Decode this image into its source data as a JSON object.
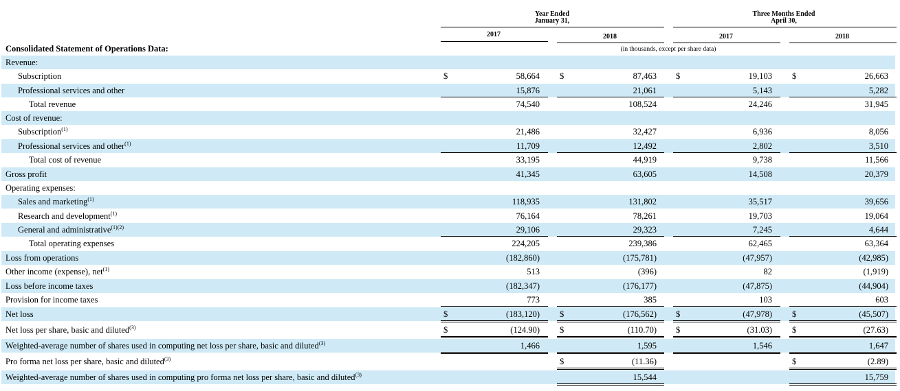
{
  "headers": {
    "year_ended": "Year Ended",
    "year_ended_date": "January 31,",
    "three_months": "Three Months Ended",
    "three_months_date": "April 30,",
    "columns": [
      "2017",
      "2018",
      "2017",
      "2018"
    ],
    "units": "(in thousands, except per share data)"
  },
  "section_title": "Consolidated Statement of Operations Data:",
  "rows": [
    {
      "label": "Revenue:",
      "indent": 0,
      "shade": true,
      "values": []
    },
    {
      "label": "Subscription",
      "indent": 1,
      "shade": false,
      "dollars": true,
      "values": [
        "58,664",
        "87,463",
        "19,103",
        "26,663"
      ]
    },
    {
      "label": "Professional services and other",
      "indent": 1,
      "shade": true,
      "values": [
        "15,876",
        "21,061",
        "5,143",
        "5,282"
      ]
    },
    {
      "label": "Total revenue",
      "indent": 2,
      "shade": false,
      "values": [
        "74,540",
        "108,524",
        "24,246",
        "31,945"
      ]
    },
    {
      "label": "Cost of revenue:",
      "indent": 0,
      "shade": true,
      "values": []
    },
    {
      "label": "Subscription",
      "sup": "(1)",
      "indent": 1,
      "shade": false,
      "values": [
        "21,486",
        "32,427",
        "6,936",
        "8,056"
      ]
    },
    {
      "label": "Professional services and other",
      "sup": "(1)",
      "indent": 1,
      "shade": true,
      "values": [
        "11,709",
        "12,492",
        "2,802",
        "3,510"
      ]
    },
    {
      "label": "Total cost of revenue",
      "indent": 2,
      "shade": false,
      "values": [
        "33,195",
        "44,919",
        "9,738",
        "11,566"
      ]
    },
    {
      "label": "Gross profit",
      "indent": 0,
      "shade": true,
      "values": [
        "41,345",
        "63,605",
        "14,508",
        "20,379"
      ]
    },
    {
      "label": "Operating expenses:",
      "indent": 0,
      "shade": false,
      "values": []
    },
    {
      "label": "Sales and marketing",
      "sup": "(1)",
      "indent": 1,
      "shade": true,
      "values": [
        "118,935",
        "131,802",
        "35,517",
        "39,656"
      ]
    },
    {
      "label": "Research and development",
      "sup": "(1)",
      "indent": 1,
      "shade": false,
      "values": [
        "76,164",
        "78,261",
        "19,703",
        "19,064"
      ]
    },
    {
      "label": "General and administrative",
      "sup": "(1)(2)",
      "indent": 1,
      "shade": true,
      "values": [
        "29,106",
        "29,323",
        "7,245",
        "4,644"
      ]
    },
    {
      "label": "Total operating expenses",
      "indent": 2,
      "shade": false,
      "values": [
        "224,205",
        "239,386",
        "62,465",
        "63,364"
      ]
    },
    {
      "label": "Loss from operations",
      "indent": 0,
      "shade": true,
      "values": [
        "(182,860)",
        "(175,781)",
        "(47,957)",
        "(42,985)"
      ]
    },
    {
      "label": "Other income (expense), net",
      "sup": "(1)",
      "indent": 0,
      "shade": false,
      "values": [
        "513",
        "(396)",
        "82",
        "(1,919)"
      ]
    },
    {
      "label": "Loss before income taxes",
      "indent": 0,
      "shade": true,
      "values": [
        "(182,347)",
        "(176,177)",
        "(47,875)",
        "(44,904)"
      ]
    },
    {
      "label": "Provision for income taxes",
      "indent": 0,
      "shade": false,
      "values": [
        "773",
        "385",
        "103",
        "603"
      ]
    },
    {
      "label": "Net loss",
      "indent": 0,
      "shade": true,
      "dollars": true,
      "values": [
        "(183,120)",
        "(176,562)",
        "(47,978)",
        "(45,507)"
      ]
    },
    {
      "label": "Net loss per share, basic and diluted",
      "sup": "(3)",
      "indent": 0,
      "shade": false,
      "dollars": true,
      "values": [
        "(124.90)",
        "(110.70)",
        "(31.03)",
        "(27.63)"
      ]
    },
    {
      "label": "Weighted-average number of shares used in computing net loss per share, basic and diluted",
      "sup": "(3)",
      "indent": 0,
      "shade": true,
      "values": [
        "1,466",
        "1,595",
        "1,546",
        "1,647"
      ]
    },
    {
      "label": "Pro forma net loss per share, basic and diluted",
      "sup": "(3)",
      "indent": 0,
      "shade": false,
      "dollars_pro": true,
      "values": [
        "",
        "(11.36)",
        "",
        "(2.89)"
      ]
    },
    {
      "label": "Weighted-average number of shares used in computing pro forma net loss per share, basic and diluted",
      "sup": "(3)",
      "indent": 0,
      "shade": true,
      "values": [
        "",
        "15,544",
        "",
        "15,759"
      ]
    }
  ],
  "currency_symbol": "$"
}
